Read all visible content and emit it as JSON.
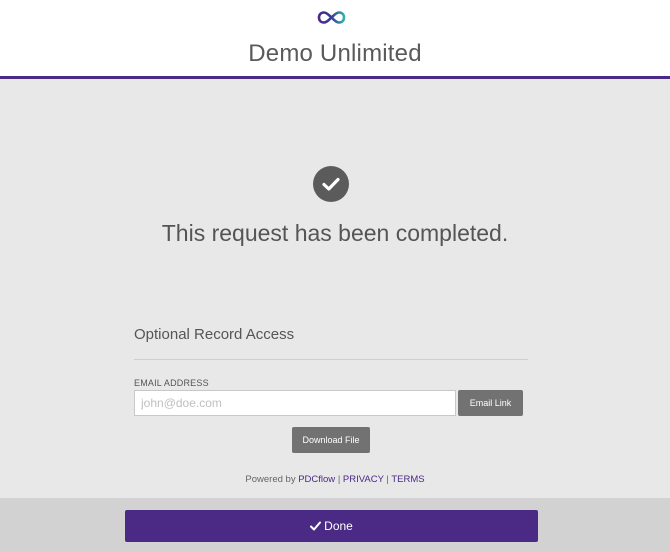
{
  "header": {
    "logo_icon": "infinity-icon",
    "title": "Demo Unlimited",
    "accent_color": "#4b2a86"
  },
  "status": {
    "icon": "check-circle-icon",
    "message": "This request has been completed."
  },
  "record_access": {
    "title": "Optional Record Access",
    "email_label": "EMAIL ADDRESS",
    "email_value": "",
    "email_placeholder": "john@doe.com",
    "email_link_label": "Email Link",
    "download_label": "Download File"
  },
  "footer": {
    "powered_by": "Powered by",
    "brand_link": "PDCflow",
    "separator": "|",
    "privacy_link": "PRIVACY",
    "terms_link": "TERMS"
  },
  "done_button": {
    "icon": "checkmark-icon",
    "label": "Done"
  }
}
